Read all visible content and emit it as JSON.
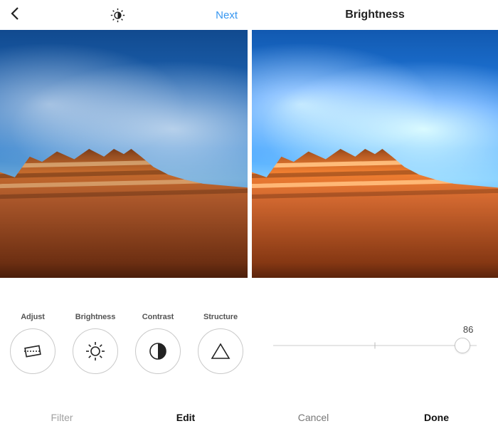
{
  "left": {
    "topbar": {
      "back_icon": "chevron-left",
      "center_icon": "half-sun",
      "next_label": "Next"
    },
    "tools": [
      {
        "label": "Adjust",
        "icon": "crop-rotate"
      },
      {
        "label": "Brightness",
        "icon": "sun"
      },
      {
        "label": "Contrast",
        "icon": "half-circle"
      },
      {
        "label": "Structure",
        "icon": "triangle"
      }
    ],
    "tabs": {
      "filter_label": "Filter",
      "edit_label": "Edit",
      "active": "Edit"
    }
  },
  "right": {
    "topbar": {
      "title": "Brightness"
    },
    "slider": {
      "value": 86,
      "min": -100,
      "max": 100,
      "center_tick_at": 0
    },
    "actions": {
      "cancel_label": "Cancel",
      "done_label": "Done"
    }
  },
  "colors": {
    "accent": "#3897f0"
  }
}
